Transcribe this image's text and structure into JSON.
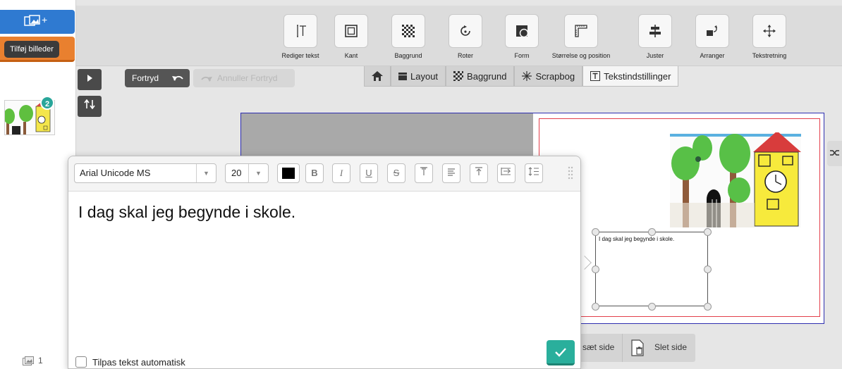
{
  "sidebar": {
    "add_photos_plus": "+",
    "tooltip": "Tilføj billeder",
    "thumbnail_badge": "2",
    "image_count": "1"
  },
  "toolbar": {
    "tools": [
      {
        "label": "Rediger tekst",
        "icon": "edit-text-icon"
      },
      {
        "label": "Kant",
        "icon": "border-icon"
      },
      {
        "label": "Baggrund",
        "icon": "background-icon"
      },
      {
        "label": "Roter",
        "icon": "rotate-icon"
      },
      {
        "label": "Form",
        "icon": "shape-icon"
      },
      {
        "label": "Størrelse og position",
        "icon": "size-position-icon"
      },
      {
        "label": "Juster",
        "icon": "align-icon"
      },
      {
        "label": "Arranger",
        "icon": "arrange-icon"
      },
      {
        "label": "Tekstretning",
        "icon": "text-direction-icon"
      }
    ]
  },
  "history": {
    "undo": "Fortryd",
    "redo": "Annuller Fortryd"
  },
  "tabs": [
    {
      "label": "Layout"
    },
    {
      "label": "Baggrund"
    },
    {
      "label": "Scrapbog"
    },
    {
      "label": "Tekstindstillinger",
      "active": true
    }
  ],
  "canvas": {
    "textbox_text": "I dag skal jeg begynde i skole."
  },
  "page_actions": {
    "insert": "sæt side",
    "delete": "Slet side"
  },
  "editor": {
    "font": "Arial Unicode MS",
    "size": "20",
    "text_color": "#000000",
    "text": "I dag skal jeg begynde i skole.",
    "autofit_label": "Tilpas tekst automatisk",
    "autofit_checked": false
  },
  "colors": {
    "primary_blue": "#2f7ad1",
    "orange": "#e9802f",
    "teal": "#2aaf9c",
    "page_border_red": "#e33f4b",
    "spread_border_blue": "#2e2eb0"
  }
}
